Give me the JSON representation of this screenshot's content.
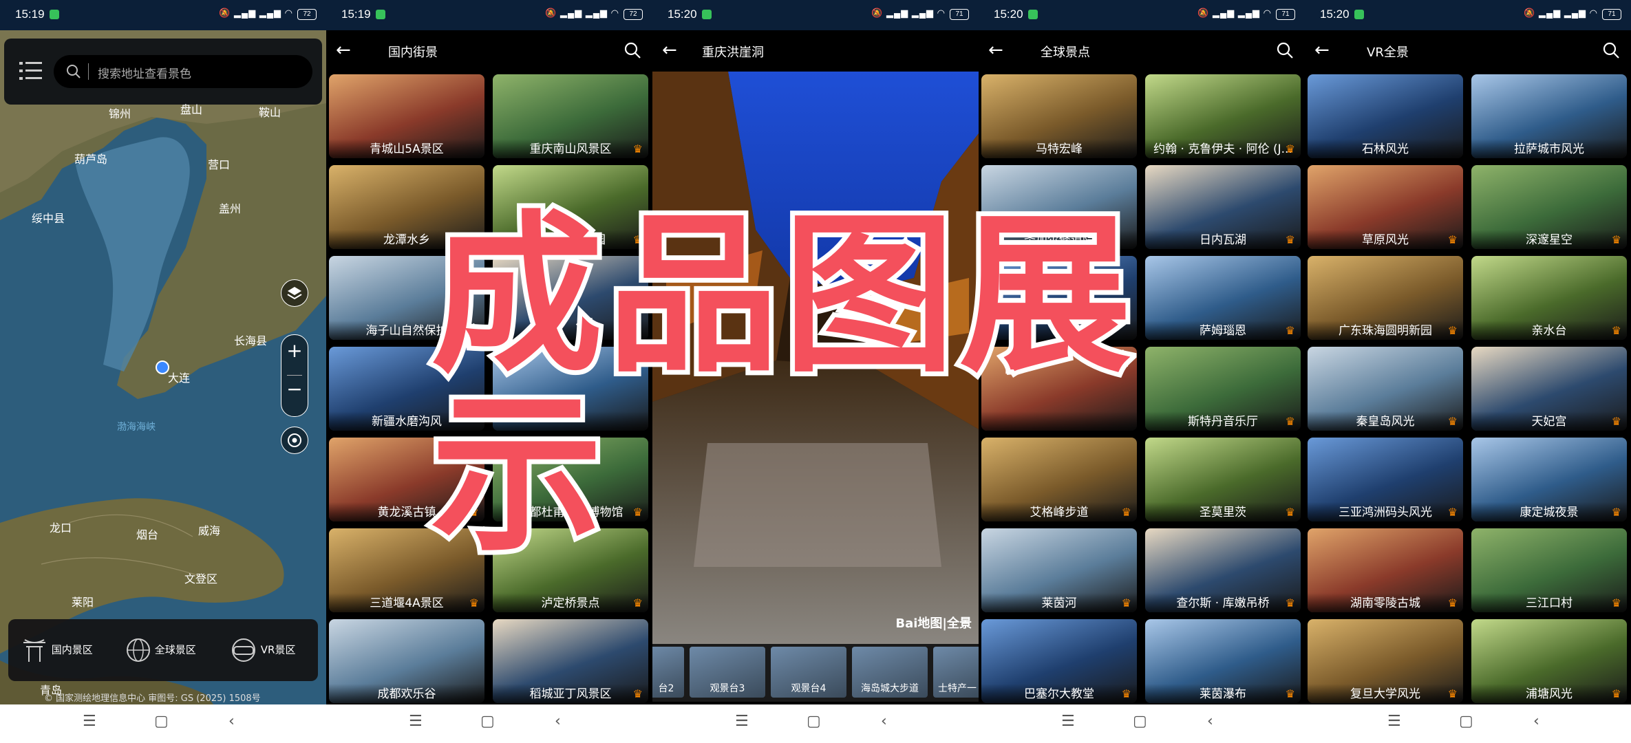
{
  "phones": [
    {
      "time": "15:19",
      "battery": "72"
    },
    {
      "time": "15:19",
      "battery": "72"
    },
    {
      "time": "15:20",
      "battery": "71"
    },
    {
      "time": "15:20",
      "battery": "71"
    },
    {
      "time": "15:20",
      "battery": "71"
    }
  ],
  "map": {
    "search_placeholder": "搜索地址查看景色",
    "cities": [
      "锦州",
      "盘山",
      "鞍山",
      "葫芦岛",
      "营口",
      "绥中县",
      "盖州",
      "长海县",
      "大连",
      "龙口",
      "烟台",
      "威海",
      "文登区",
      "莱阳",
      "青岛",
      "渤海海峡"
    ],
    "copyright": "© 国家测绘地理信息中心  审图号: GS (2025) 1508号",
    "categories": [
      "国内景区",
      "全球景区",
      "VR景区"
    ]
  },
  "domestic": {
    "title": "国内街景",
    "items": [
      {
        "label": "青城山5A景区",
        "vip": false
      },
      {
        "label": "重庆南山风景区",
        "vip": true
      },
      {
        "label": "龙潭水乡",
        "vip": false
      },
      {
        "label": "甘孜白塔公园",
        "vip": true
      },
      {
        "label": "海子山自然保护",
        "vip": false
      },
      {
        "label": "",
        "vip": false
      },
      {
        "label": "新疆水磨沟风",
        "vip": false
      },
      {
        "label": "",
        "vip": false
      },
      {
        "label": "黄龙溪古镇",
        "vip": true
      },
      {
        "label": "成都杜甫草堂博物馆",
        "vip": true
      },
      {
        "label": "三道堰4A景区",
        "vip": true
      },
      {
        "label": "泸定桥景点",
        "vip": true
      },
      {
        "label": "成都欢乐谷",
        "vip": false
      },
      {
        "label": "稻城亚丁风景区",
        "vip": true
      }
    ]
  },
  "viewer": {
    "title": "重庆洪崖洞",
    "watermark": "Bai地图|全景",
    "thumbs": [
      "台2",
      "观景台3",
      "观景台4",
      "海岛城大步道",
      "士特产一"
    ]
  },
  "global": {
    "title": "全球景点",
    "items": [
      {
        "label": "马特宏峰",
        "vip": false
      },
      {
        "label": "约翰 · 克鲁伊夫 · 阿伦 (J...",
        "vip": true
      },
      {
        "label": "圣加尔修道院",
        "vip": false
      },
      {
        "label": "日内瓦湖",
        "vip": true
      },
      {
        "label": "少",
        "vip": false
      },
      {
        "label": "萨姆瑙恩",
        "vip": true
      },
      {
        "label": "",
        "vip": false
      },
      {
        "label": "斯特丹音乐厅",
        "vip": true
      },
      {
        "label": "艾格峰步道",
        "vip": true
      },
      {
        "label": "圣莫里茨",
        "vip": true
      },
      {
        "label": "莱茵河",
        "vip": true
      },
      {
        "label": "查尔斯 · 库嫩吊桥",
        "vip": true
      },
      {
        "label": "巴塞尔大教堂",
        "vip": true
      },
      {
        "label": "莱茵瀑布",
        "vip": true
      }
    ]
  },
  "vr": {
    "title": "VR全景",
    "items": [
      {
        "label": "石林风光",
        "vip": false
      },
      {
        "label": "拉萨城市风光",
        "vip": false
      },
      {
        "label": "草原风光",
        "vip": true
      },
      {
        "label": "深邃星空",
        "vip": true
      },
      {
        "label": "广东珠海圆明新园",
        "vip": true
      },
      {
        "label": "亲水台",
        "vip": true
      },
      {
        "label": "秦皇岛风光",
        "vip": true
      },
      {
        "label": "天妃宫",
        "vip": true
      },
      {
        "label": "三亚鸿洲码头风光",
        "vip": true
      },
      {
        "label": "康定城夜景",
        "vip": true
      },
      {
        "label": "湖南零陵古城",
        "vip": true
      },
      {
        "label": "三江口村",
        "vip": true
      },
      {
        "label": "复旦大学风光",
        "vip": true
      },
      {
        "label": "浦塘风光",
        "vip": true
      }
    ]
  },
  "overlay_text": "成品图展示",
  "colors": {
    "accent": "#f4505c",
    "crown": "#ff8a00",
    "status_bg": "#0b1f38"
  }
}
